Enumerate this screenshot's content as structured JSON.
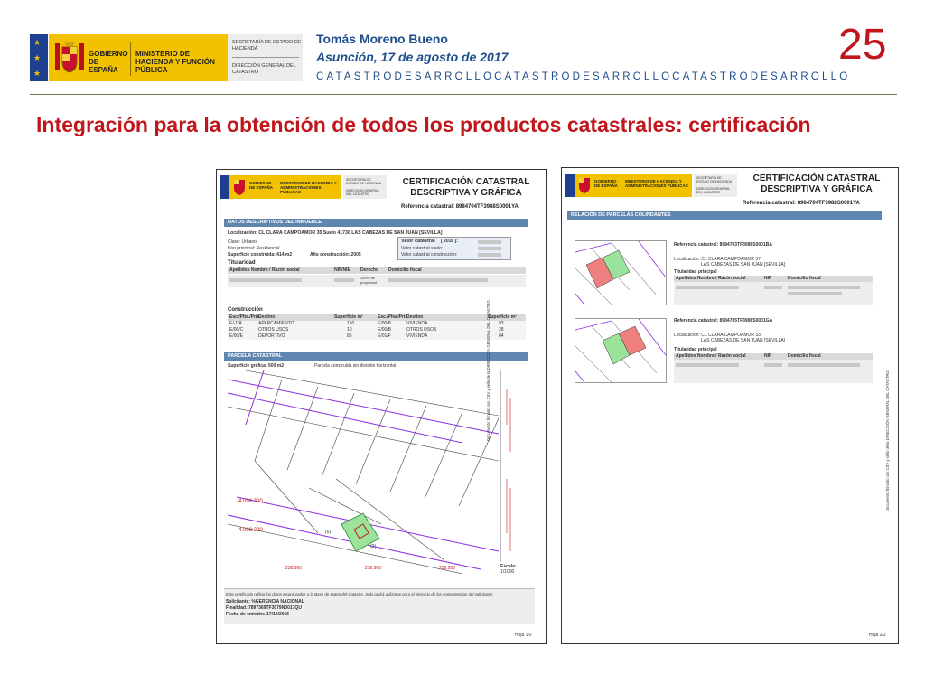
{
  "header": {
    "gov_text": "GOBIERNO DE ESPAÑA",
    "ministry_text": "MINISTERIO DE HACIENDA Y FUNCIÓN PÚBLICA",
    "secretaria": "SECRETARÍA DE ESTADO DE HACIENDA",
    "direccion": "DIRECCIÓN GENERAL DEL CATASTRO",
    "author": "Tomás Moreno Bueno",
    "date": "Asunción,  17 de agosto de 2017",
    "ticker": "CATASTRODESARROLLOCATASTRODESARROLLOCATASTRODESARROLLO",
    "page_number": "25"
  },
  "slide": {
    "title": "Integración para la obtención de todos los productos catastrales: certificación"
  },
  "doc1": {
    "gov": "GOBIERNO DE ESPAÑA",
    "ministry": "MINISTERIO DE HACIENDA Y ADMINISTRACIONES PÚBLICAS",
    "secretaria": "SECRETARÍA DE ESTADO DE HACIENDA",
    "direccion": "DIRECCIÓN GENERAL DEL CATASTRO",
    "title_line1": "CERTIFICACIÓN CATASTRAL",
    "title_line2": "DESCRIPTIVA Y GRÁFICA",
    "ref": "Referencia catastral: 8984704TF3988S0001YA",
    "bar_datos": "DATOS DESCRIPTIVOS DEL INMUEBLE",
    "localizacion": "Localización: CL CLARA CAMPOAMOR 35 Suelo 41730 LAS CABEZAS DE SAN JUAN [SEVILLA]",
    "clase": "Clase: Urbano",
    "uso": "Uso principal: Residencial",
    "superficie": "Superficie construida: 414 m2",
    "anio": "Año construcción: 2005",
    "valor_catastral": "Valor catastral",
    "valor_year": "[ 2016 ]:",
    "valor_suelo": "Valor catastral suelo:",
    "valor_const": "Valor catastral construcción:",
    "titularidad": "Titularidad",
    "tit_cols": [
      "Apellidos Nombre / Razón social",
      "NIF/NIE",
      "Derecho",
      "Domicilio fiscal"
    ],
    "tit_derecho": "100% de propiedad",
    "construccion": "Construcción",
    "cons_cols": [
      "Esc./Plta./Prta.",
      "Destino",
      "Superficie m²",
      "Esc./Plta./Prta.",
      "Destino",
      "Superficie m²"
    ],
    "cons_rows": [
      [
        "E/-1/A",
        "APARCAMIENTO",
        "150",
        "E/00/B",
        "VIVIENDA",
        "93"
      ],
      [
        "E/00/C",
        "OTROS USOS",
        "10",
        "E/00/B",
        "OTROS USOS",
        "28"
      ],
      [
        "E/00/E",
        "DEPORTIVO",
        "85",
        "E/01/F",
        "VIVIENDA",
        "84"
      ]
    ],
    "bar_parcela": "PARCELA CATASTRAL",
    "sup_grafica": "Superficie gráfica: 500 m2",
    "parcela_desc": "Parcela construida sin división horizontal",
    "map_labels": [
      "4.098.300",
      "4.098.200",
      "238.900",
      "238.900",
      "238.950",
      "(6)",
      "(2)"
    ],
    "escala": "Escala:",
    "escala_val": "1/1000",
    "footer_note": "Este certificado refleja los datos incorporados a la Base de Datos del Catastro. Sólo podrá utilizarse para el ejercicio de las competencias del solicitante.",
    "solicitante": "Solicitante: %GERENCIA NACIONAL",
    "finalidad": "Finalidad: 7897369TF3079N0017QU",
    "fecha": "Fecha de emisión: 17/10/2016",
    "hoja": "Hoja 1/2",
    "side_text": "Documento firmado con CSV y sello de la DIRECCIÓN GENERAL DEL CATASTRO"
  },
  "doc2": {
    "gov": "GOBIERNO DE ESPAÑA",
    "ministry": "MINISTERIO DE HACIENDA Y ADMINISTRACIONES PÚBLICAS",
    "secretaria": "SECRETARÍA DE ESTADO DE HACIENDA",
    "direccion": "DIRECCIÓN GENERAL DEL CATASTRO",
    "title_line1": "CERTIFICACIÓN CATASTRAL",
    "title_line2": "DESCRIPTIVA Y GRÁFICA",
    "ref": "Referencia catastral: 8984704TF3988S0001YA",
    "bar": "RELACIÓN DE PARCELAS COLINDANTES",
    "p1_ref": "Referencia catastral: 8984703TF3988S0001BA",
    "p1_loc1": "Localización: CL CLARA CAMPOAMOR 37",
    "p1_loc2": "LAS CABEZAS DE SAN JUAN [SEVILLA]",
    "p1_tit": "Titularidad principal",
    "p2_ref": "Referencia catastral: 8984705TF3988S0001GA",
    "p2_loc1": "Localización: CL CLARA CAMPOAMOR 33",
    "p2_loc2": "LAS CABEZAS DE SAN JUAN [SEVILLA]",
    "p2_tit": "Titularidad principal",
    "tcols": [
      "Apellidos Nombre / Razón social",
      "NIF",
      "Domicilio fiscal"
    ],
    "hoja": "Hoja 2/2",
    "side_text": "Documento firmado con CSV y sello de la DIRECCIÓN GENERAL DEL CATASTRO"
  },
  "colors": {
    "title_red": "#c0161c",
    "header_blue": "#1f4e8c",
    "gov_yellow": "#f2c200",
    "bar_blue": "#5f86b0",
    "map_purple": "#8a2be2",
    "parcel_green": "#9be39b",
    "parcel_red": "#f08080"
  }
}
